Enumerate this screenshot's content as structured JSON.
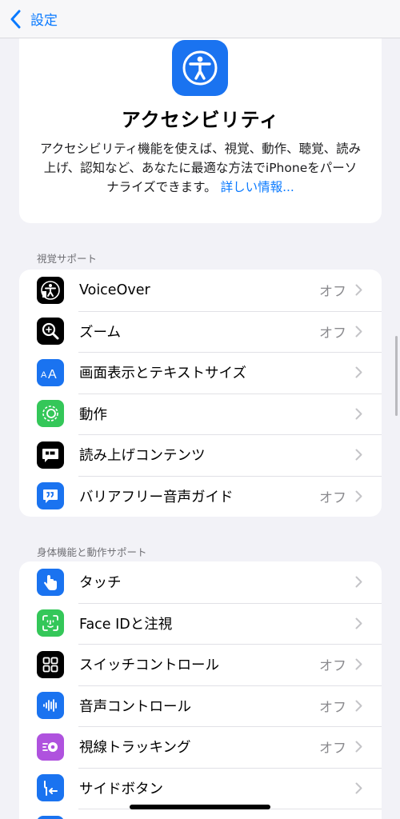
{
  "nav": {
    "back_label": "設定"
  },
  "hero": {
    "title": "アクセシビリティ",
    "line1": "アクセシビリティ機能を使えば、視覚、動作、聴覚、読み",
    "line2": "上げ、認知など、あなたに最適な方法でiPhoneをパーソ",
    "line3": "ナライズできます。",
    "link": "詳しい情報..."
  },
  "vision": {
    "header": "視覚サポート",
    "items": [
      {
        "label": "VoiceOver",
        "value": "オフ",
        "icon": "voiceover-icon",
        "color": "#000000"
      },
      {
        "label": "ズーム",
        "value": "オフ",
        "icon": "zoom-icon",
        "color": "#000000"
      },
      {
        "label": "画面表示とテキストサイズ",
        "value": "",
        "icon": "text-size-icon",
        "color": "#1a73f0"
      },
      {
        "label": "動作",
        "value": "",
        "icon": "motion-icon",
        "color": "#34c759"
      },
      {
        "label": "読み上げコンテンツ",
        "value": "",
        "icon": "spoken-content-icon",
        "color": "#000000"
      },
      {
        "label": "バリアフリー音声ガイド",
        "value": "オフ",
        "icon": "audio-description-icon",
        "color": "#1a73f0"
      }
    ]
  },
  "physical": {
    "header": "身体機能と動作サポート",
    "items": [
      {
        "label": "タッチ",
        "value": "",
        "icon": "touch-icon",
        "color": "#1a73f0"
      },
      {
        "label": "Face IDと注視",
        "value": "",
        "icon": "face-id-icon",
        "color": "#34c759"
      },
      {
        "label": "スイッチコントロール",
        "value": "オフ",
        "icon": "switch-control-icon",
        "color": "#000000"
      },
      {
        "label": "音声コントロール",
        "value": "オフ",
        "icon": "voice-control-icon",
        "color": "#1a73f0"
      },
      {
        "label": "視線トラッキング",
        "value": "オフ",
        "icon": "eye-tracking-icon",
        "color": "#af52de"
      },
      {
        "label": "サイドボタン",
        "value": "",
        "icon": "side-button-icon",
        "color": "#1a73f0"
      }
    ]
  }
}
